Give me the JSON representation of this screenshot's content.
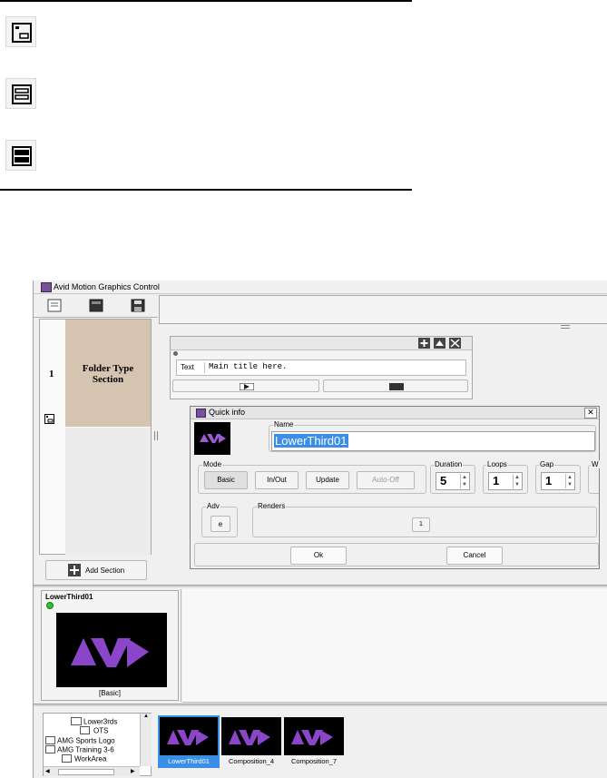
{
  "app": {
    "title": "Avid Motion Graphics Control"
  },
  "section": {
    "number": "1",
    "title": "Folder Type Section"
  },
  "add_section": {
    "label": "Add Section"
  },
  "template": {
    "text_label": "Text",
    "text_value": "Main title here."
  },
  "quick_info": {
    "title": "Quick info",
    "name_label": "Name",
    "name_value": "LowerThird01",
    "mode_label": "Mode",
    "modes": [
      "Basic",
      "In/Out",
      "Update",
      "Auto-Off"
    ],
    "duration_label": "Duration",
    "duration_value": "5",
    "loops_label": "Loops",
    "loops_value": "1",
    "gap_label": "Gap",
    "gap_value": "1",
    "w_label": "W",
    "adv_label": "Adv",
    "adv_value": "e",
    "renders_label": "Renders",
    "renders_value": "1",
    "ok_label": "Ok",
    "cancel_label": "Cancel"
  },
  "preview": {
    "name": "LowerThird01",
    "mode": "[Basic]"
  },
  "tree": {
    "items": [
      "Lower3rds",
      "OTS",
      "AMG Sports Logo",
      "AMG Training 3-6",
      "WorkArea"
    ]
  },
  "compositions": [
    "LowerThird01",
    "Composition_4",
    "Composition_7"
  ],
  "colors": {
    "tan": "#d4c4b0",
    "selected": "#3a8ee6",
    "avid_purple": "#8b45c8"
  }
}
